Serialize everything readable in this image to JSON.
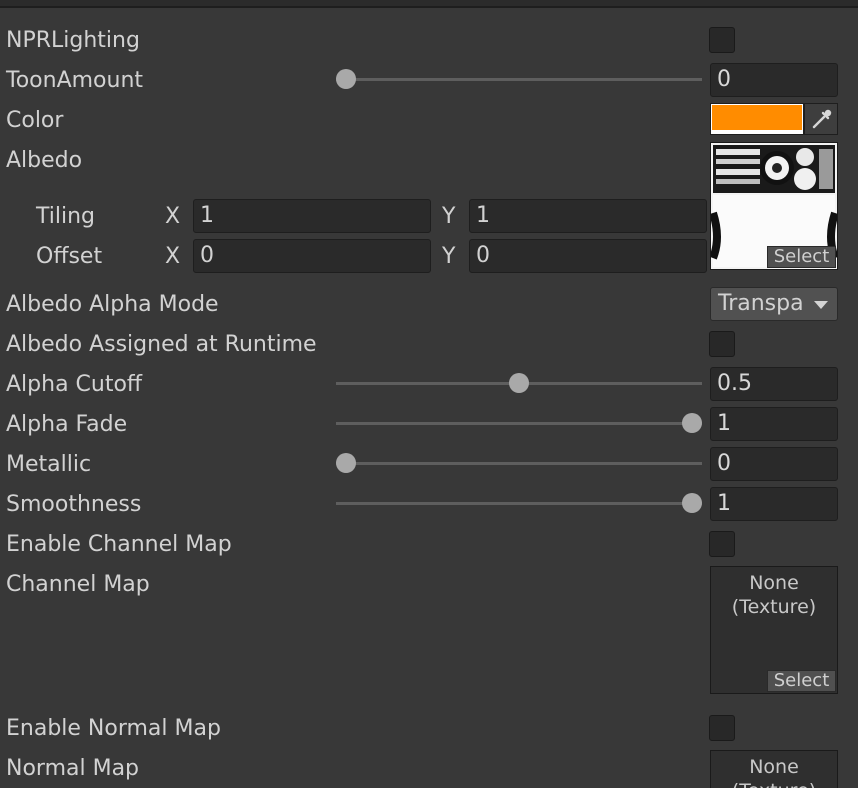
{
  "properties": {
    "npr_lighting": {
      "label": "NPRLighting"
    },
    "toon_amount": {
      "label": "ToonAmount",
      "value": "0",
      "slider_fraction": 0
    },
    "color": {
      "label": "Color",
      "swatch": "#ff8c00"
    },
    "albedo": {
      "label": "Albedo",
      "tiling": {
        "label": "Tiling",
        "x_label": "X",
        "x": "1",
        "y_label": "Y",
        "y": "1"
      },
      "offset": {
        "label": "Offset",
        "x_label": "X",
        "x": "0",
        "y_label": "Y",
        "y": "0"
      },
      "select_label": "Select"
    },
    "albedo_alpha_mode": {
      "label": "Albedo Alpha Mode",
      "value": "Transpa"
    },
    "albedo_runtime": {
      "label": "Albedo Assigned at Runtime"
    },
    "alpha_cutoff": {
      "label": "Alpha Cutoff",
      "value": "0.5",
      "slider_fraction": 0.5
    },
    "alpha_fade": {
      "label": "Alpha Fade",
      "value": "1",
      "slider_fraction": 1
    },
    "metallic": {
      "label": "Metallic",
      "value": "0",
      "slider_fraction": 0
    },
    "smoothness": {
      "label": "Smoothness",
      "value": "1",
      "slider_fraction": 1
    },
    "enable_channel_map": {
      "label": "Enable Channel Map"
    },
    "channel_map": {
      "label": "Channel Map",
      "none_line1": "None",
      "none_line2": "(Texture)",
      "select_label": "Select"
    },
    "enable_normal_map": {
      "label": "Enable Normal Map"
    },
    "normal_map": {
      "label": "Normal Map",
      "none_line1": "None",
      "none_line2": "(Texture)"
    }
  },
  "icons": {
    "eyedropper": "eyedropper-icon",
    "dropdown": "dropdown-arrow-icon"
  }
}
